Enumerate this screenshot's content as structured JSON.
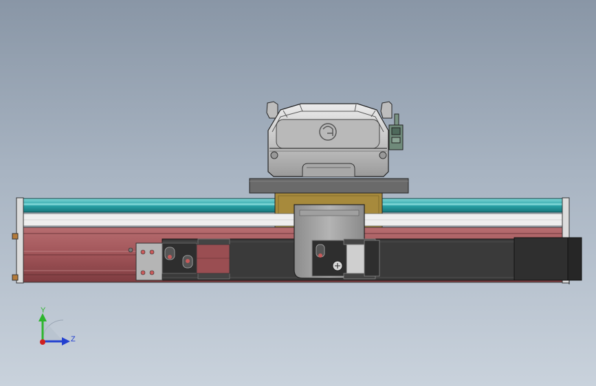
{
  "triad": {
    "y_label": "Y",
    "z_label": "Z",
    "y_color": "#2db52d",
    "z_color": "#2340d0",
    "x_color": "#d02020"
  },
  "colors": {
    "background_top": "#8996a6",
    "background_bottom": "#c9d2dc",
    "rail_body": "#a35a5e",
    "rail_cover": "#2fa9ad",
    "carriage_block": "#a38a3a",
    "motor_body": "#c8c8c8",
    "slider_plate": "#9a9a9a",
    "dark_parts": "#3a3a3a"
  }
}
